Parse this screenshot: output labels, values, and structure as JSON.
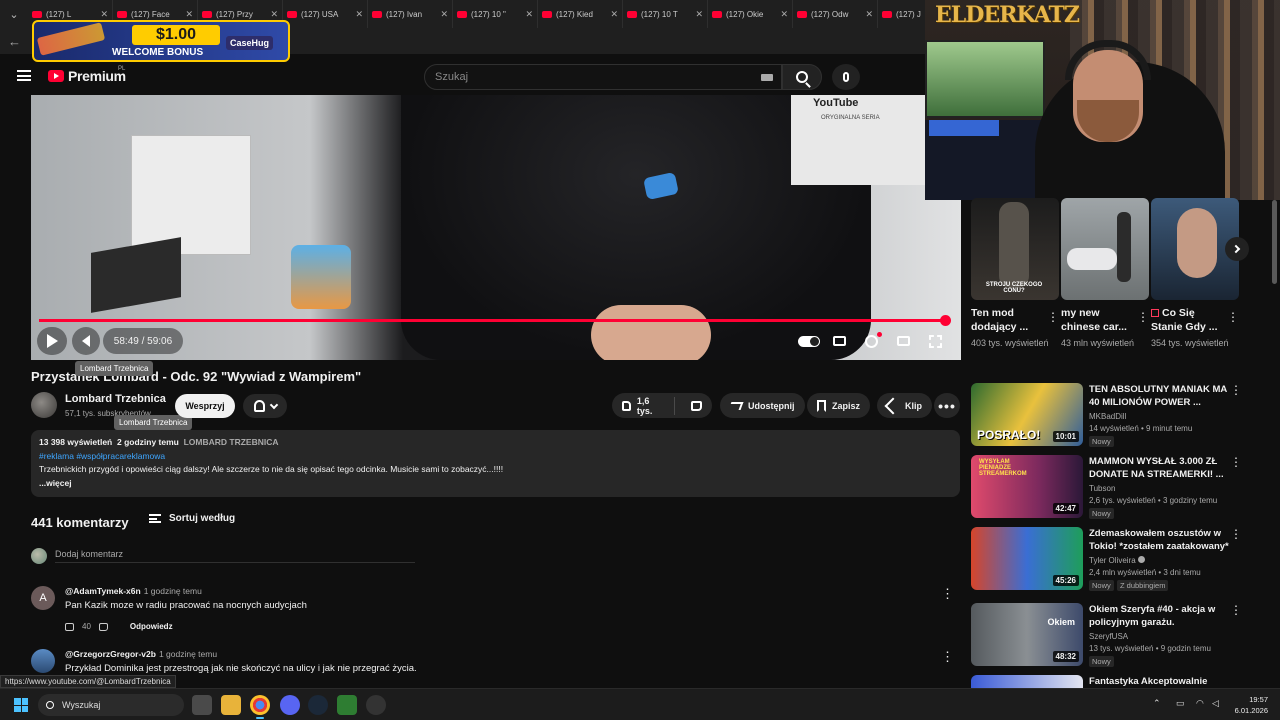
{
  "browser": {
    "tabs": [
      {
        "title": "(127) L"
      },
      {
        "title": "(127) Face"
      },
      {
        "title": "(127) Przy"
      },
      {
        "title": "(127) USA"
      },
      {
        "title": "(127) Ivan"
      },
      {
        "title": "(127) 10 \""
      },
      {
        "title": "(127) Kied"
      },
      {
        "title": "(127) 10 T"
      },
      {
        "title": "(127) Okie"
      },
      {
        "title": "(127) Odw"
      },
      {
        "title": "(127) J"
      }
    ]
  },
  "promo": {
    "amount": "$1.00",
    "text": "WELCOME BONUS",
    "brand": "CaseHug"
  },
  "header": {
    "logo": "Premium",
    "country": "PL",
    "search_placeholder": "Szukaj"
  },
  "player": {
    "time": "58:49 / 59:06",
    "progress_fraction": 0.995,
    "video_watermark": "YouTube",
    "video_watermark_sub": "ORYGINALNA SERIA"
  },
  "webcam": {
    "name": "ELDERKATZ"
  },
  "video": {
    "title": "Przystanek Lombard - Odc. 92 \"Wywiad z Wampirem\"",
    "title_tooltip": "Lombard Trzebnica",
    "channel": "Lombard Trzebnica",
    "channel_tooltip": "Lombard Trzebnica",
    "subs": "57,1 tys. subskrybentów",
    "support": "Wesprzyj",
    "likes": "1,6 tys.",
    "share": "Udostępnij",
    "save": "Zapisz",
    "clip": "Klip"
  },
  "description": {
    "views": "13 398 wyświetleń",
    "age": "2 godziny temu",
    "channel_upper": "LOMBARD TRZEBNICA",
    "tags": "#reklama #współpracareklamowa",
    "text": "Trzebnickich przygód i opowieści ciąg dalszy! Ale szczerze to nie da się opisać tego odcinka. Musicie sami to zobaczyć...!!!!",
    "more": "...więcej"
  },
  "comments": {
    "count": "441 komentarzy",
    "sort_label": "Sortuj według",
    "add_placeholder": "Dodaj komentarz",
    "reply_label": "Odpowiedz",
    "items": [
      {
        "author": "@AdamTymek-x6n",
        "time": "1 godzinę temu",
        "text": "Pan Kazik moze w radiu pracować na nocnych audycjach",
        "likes": "40",
        "initial": "A"
      },
      {
        "author": "@GrzegorzGregor-v2b",
        "time": "1 godzinę temu",
        "text": "Przykład Dominika jest przestrogą jak nie skończyć na ulicy i jak nie przegrać życia.",
        "likes": "",
        "initial": ""
      }
    ]
  },
  "shorts": [
    {
      "title": "Ten mod dodający ...",
      "views": "403 tys. wyświetleń",
      "overlay": "STROJU CZEKOGO CONU?"
    },
    {
      "title": "my new chinese car...",
      "views": "43 mln wyświetleń",
      "overlay": ""
    },
    {
      "title": "Co Się Stanie Gdy ...",
      "views": "354 tys. wyświetleń",
      "overlay": ""
    }
  ],
  "recommendations": [
    {
      "title": "TEN ABSOLUTNY MANIAK MA 40 MILIONÓW POWER ...",
      "channel": "MKBadDill",
      "meta": "14 wyświetleń • 9 minut temu",
      "badge": "Nowy",
      "badge2": "",
      "duration": "10:01",
      "thumb_text": "POSRAŁO!"
    },
    {
      "title": "MAMMON WYSŁAŁ 3.000 ZŁ DONATE NA STREAMERKI! ...",
      "channel": "Tubson",
      "meta": "2,6 tys. wyświetleń • 3 godziny temu",
      "badge": "Nowy",
      "badge2": "",
      "duration": "42:47",
      "thumb_text": "WYSYŁAM PIENIĄDZE STREAMERKOM"
    },
    {
      "title": "Zdemaskowałem oszustów w Tokio! *zostałem zaatakowany*",
      "channel": "Tyler Oliveira",
      "meta": "2,4 mln wyświetleń • 3 dni temu",
      "badge": "Nowy",
      "badge2": "Z dubbingiem",
      "duration": "45:26",
      "thumb_text": ""
    },
    {
      "title": "Okiem Szeryfa #40 - akcja w policyjnym garażu.",
      "channel": "SzeryfUSA",
      "meta": "13 tys. wyświetleń • 9 godzin temu",
      "badge": "Nowy",
      "badge2": "",
      "duration": "48:32",
      "thumb_text": "Okiem"
    },
    {
      "title": "Fantastyka Akceptowalnie",
      "channel": "",
      "meta": "",
      "badge": "",
      "badge2": "",
      "duration": "",
      "thumb_text": ""
    }
  ],
  "status_url": "https://www.youtube.com/@LombardTrzebnica",
  "taskbar": {
    "search": "Wyszukaj",
    "time": "19:57",
    "date": "6.01.2026"
  }
}
